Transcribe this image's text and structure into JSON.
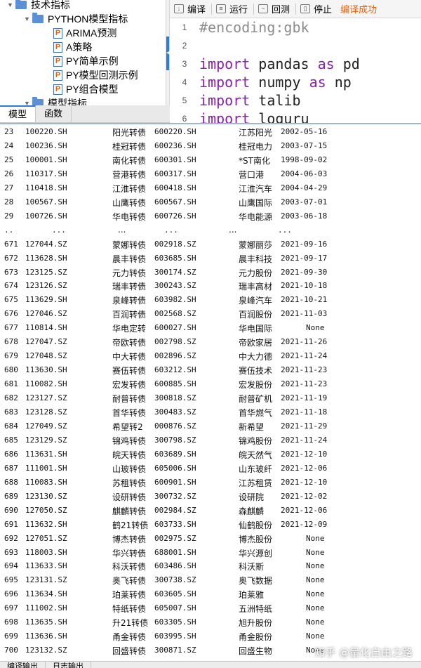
{
  "tree": {
    "items": [
      {
        "label": "技术指标",
        "kind": "folder",
        "level": 0
      },
      {
        "label": "PYTHON模型指标",
        "kind": "folder",
        "level": 1
      },
      {
        "label": "ARIMA预测",
        "kind": "py",
        "level": 2
      },
      {
        "label": "A策略",
        "kind": "py",
        "level": 2
      },
      {
        "label": "PY简单示例",
        "kind": "py",
        "level": 2
      },
      {
        "label": "PY模型回测示例",
        "kind": "py",
        "level": 2
      },
      {
        "label": "PY组合模型",
        "kind": "py",
        "level": 2
      },
      {
        "label": "模型指标",
        "kind": "folder",
        "level": 1
      }
    ]
  },
  "toolbar": {
    "compile": "编译",
    "run": "运行",
    "backtest": "回测",
    "stop": "停止",
    "status": "编译成功"
  },
  "editor": {
    "lines": [
      {
        "n": "1",
        "text": "#encoding:gbk"
      },
      {
        "n": "2",
        "text": ""
      },
      {
        "n": "3",
        "kw": "import",
        "mod": "pandas",
        "as": "as",
        "alias": "pd"
      },
      {
        "n": "4",
        "kw": "import",
        "mod": "numpy",
        "as": "as",
        "alias": "np"
      },
      {
        "n": "5",
        "kw": "import",
        "mod": "talib",
        "as": "",
        "alias": ""
      },
      {
        "n": "6",
        "kw": "import",
        "mod": "loguru",
        "as": "",
        "alias": ""
      }
    ]
  },
  "tabs": {
    "model": "模型",
    "function": "函数"
  },
  "output": {
    "rows": [
      [
        "23",
        "100220.SH",
        "阳光转债",
        "600220.SH",
        "江苏阳光",
        "2002-05-16"
      ],
      [
        "24",
        "100236.SH",
        "桂冠转债",
        "600236.SH",
        "桂冠电力",
        "2003-07-15"
      ],
      [
        "25",
        "100001.SH",
        "南化转债",
        "600301.SH",
        "*ST南化",
        "1998-09-02"
      ],
      [
        "26",
        "110317.SH",
        "营港转债",
        "600317.SH",
        "营口港",
        "2004-06-03"
      ],
      [
        "27",
        "110418.SH",
        "江淮转债",
        "600418.SH",
        "江淮汽车",
        "2004-04-29"
      ],
      [
        "28",
        "100567.SH",
        "山鹰转债",
        "600567.SH",
        "山鹰国际",
        "2003-07-01"
      ],
      [
        "29",
        "100726.SH",
        "华电转债",
        "600726.SH",
        "华电能源",
        "2003-06-18"
      ],
      [
        "..",
        "...",
        "...",
        "...",
        "...",
        "..."
      ],
      [
        "671",
        "127044.SZ",
        "蒙娜转债",
        "002918.SZ",
        "蒙娜丽莎",
        "2021-09-16"
      ],
      [
        "672",
        "113628.SH",
        "晨丰转债",
        "603685.SH",
        "晨丰科技",
        "2021-09-17"
      ],
      [
        "673",
        "123125.SZ",
        "元力转债",
        "300174.SZ",
        "元力股份",
        "2021-09-30"
      ],
      [
        "674",
        "123126.SZ",
        "瑞丰转债",
        "300243.SZ",
        "瑞丰高材",
        "2021-10-18"
      ],
      [
        "675",
        "113629.SH",
        "泉峰转债",
        "603982.SH",
        "泉峰汽车",
        "2021-10-21"
      ],
      [
        "676",
        "127046.SZ",
        "百润转债",
        "002568.SZ",
        "百润股份",
        "2021-11-03"
      ],
      [
        "677",
        "110814.SH",
        "华电定转",
        "600027.SH",
        "华电国际",
        "None"
      ],
      [
        "678",
        "127047.SZ",
        "帝欧转债",
        "002798.SZ",
        "帝欧家居",
        "2021-11-26"
      ],
      [
        "679",
        "127048.SZ",
        "中大转债",
        "002896.SZ",
        "中大力德",
        "2021-11-24"
      ],
      [
        "680",
        "113630.SH",
        "赛伍转债",
        "603212.SH",
        "赛伍技术",
        "2021-11-23"
      ],
      [
        "681",
        "110082.SH",
        "宏发转债",
        "600885.SH",
        "宏发股份",
        "2021-11-23"
      ],
      [
        "682",
        "123127.SZ",
        "耐普转债",
        "300818.SZ",
        "耐普矿机",
        "2021-11-19"
      ],
      [
        "683",
        "123128.SZ",
        "首华转债",
        "300483.SZ",
        "首华燃气",
        "2021-11-18"
      ],
      [
        "684",
        "127049.SZ",
        "希望转2",
        "000876.SZ",
        "新希望",
        "2021-11-29"
      ],
      [
        "685",
        "123129.SZ",
        "锦鸡转债",
        "300798.SZ",
        "锦鸡股份",
        "2021-11-24"
      ],
      [
        "686",
        "113631.SH",
        "皖天转债",
        "603689.SH",
        "皖天然气",
        "2021-12-10"
      ],
      [
        "687",
        "111001.SH",
        "山玻转债",
        "605006.SH",
        "山东玻纤",
        "2021-12-06"
      ],
      [
        "688",
        "110083.SH",
        "苏租转债",
        "600901.SH",
        "江苏租赁",
        "2021-12-10"
      ],
      [
        "689",
        "123130.SZ",
        "设研转债",
        "300732.SZ",
        "设研院",
        "2021-12-02"
      ],
      [
        "690",
        "127050.SZ",
        "麒麟转债",
        "002984.SZ",
        "森麒麟",
        "2021-12-06"
      ],
      [
        "691",
        "113632.SH",
        "鹤21转债",
        "603733.SH",
        "仙鹤股份",
        "2021-12-09"
      ],
      [
        "692",
        "127051.SZ",
        "博杰转债",
        "002975.SZ",
        "博杰股份",
        "None"
      ],
      [
        "693",
        "118003.SH",
        "华兴转债",
        "688001.SH",
        "华兴源创",
        "None"
      ],
      [
        "694",
        "113633.SH",
        "科沃转债",
        "603486.SH",
        "科沃斯",
        "None"
      ],
      [
        "695",
        "123131.SZ",
        "奥飞转债",
        "300738.SZ",
        "奥飞数据",
        "None"
      ],
      [
        "696",
        "113634.SH",
        "珀莱转债",
        "603605.SH",
        "珀莱雅",
        "None"
      ],
      [
        "697",
        "111002.SH",
        "特纸转债",
        "605007.SH",
        "五洲特纸",
        "None"
      ],
      [
        "698",
        "113635.SH",
        "升21转债",
        "603305.SH",
        "旭升股份",
        "None"
      ],
      [
        "699",
        "113636.SH",
        "甬金转债",
        "603995.SH",
        "甬金股份",
        "None"
      ],
      [
        "700",
        "123132.SZ",
        "回盛转债",
        "300871.SZ",
        "回盛生物",
        "None"
      ]
    ]
  },
  "watermark": "知乎 @量化自由之路",
  "bottom_tabs": [
    "编译输出",
    "日志输出"
  ]
}
